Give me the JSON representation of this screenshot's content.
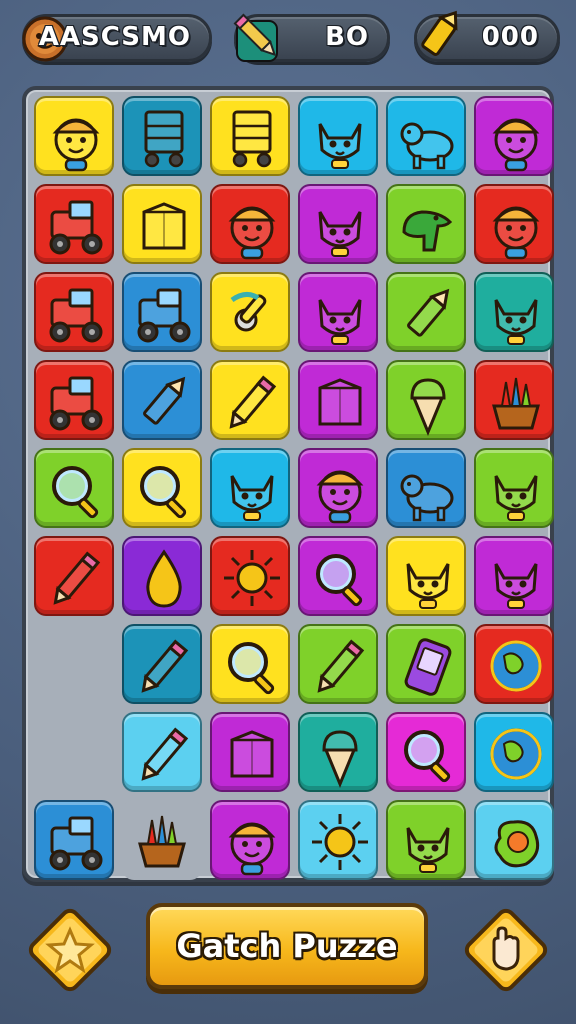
{
  "header": {
    "player_name": "AASCSMO",
    "pencil_count": "BO",
    "coin_count": "000",
    "icons": [
      "avatar-icon",
      "pencil-icon",
      "crayon-icon"
    ]
  },
  "board": {
    "tiles": [
      {
        "row": 0,
        "col": 0,
        "bg": "#ffe11f",
        "icon": "kid-icon"
      },
      {
        "row": 0,
        "col": 1,
        "bg": "#1c93b8",
        "icon": "cart-icon"
      },
      {
        "row": 0,
        "col": 2,
        "bg": "#ffe11f",
        "icon": "cart-icon"
      },
      {
        "row": 0,
        "col": 3,
        "bg": "#1fb8e8",
        "icon": "cat-icon"
      },
      {
        "row": 0,
        "col": 4,
        "bg": "#1fb8e8",
        "icon": "bear-icon"
      },
      {
        "row": 0,
        "col": 5,
        "bg": "#c02ad6",
        "icon": "kid-icon"
      },
      {
        "row": 1,
        "col": 0,
        "bg": "#e52a20",
        "icon": "tractor-icon"
      },
      {
        "row": 1,
        "col": 1,
        "bg": "#ffe11f",
        "icon": "box-icon"
      },
      {
        "row": 1,
        "col": 2,
        "bg": "#e52a20",
        "icon": "kid-icon"
      },
      {
        "row": 1,
        "col": 3,
        "bg": "#c02ad6",
        "icon": "cat-icon"
      },
      {
        "row": 1,
        "col": 4,
        "bg": "#7fd12a",
        "icon": "dino-icon"
      },
      {
        "row": 1,
        "col": 5,
        "bg": "#e52a20",
        "icon": "kid-icon"
      },
      {
        "row": 2,
        "col": 0,
        "bg": "#e52a20",
        "icon": "tractor-icon"
      },
      {
        "row": 2,
        "col": 1,
        "bg": "#2c8fd6",
        "icon": "tractor-icon"
      },
      {
        "row": 2,
        "col": 2,
        "bg": "#ffe11f",
        "icon": "tool-icon"
      },
      {
        "row": 2,
        "col": 3,
        "bg": "#c02ad6",
        "icon": "cat-icon"
      },
      {
        "row": 2,
        "col": 4,
        "bg": "#7fd12a",
        "icon": "crayon-icon"
      },
      {
        "row": 2,
        "col": 5,
        "bg": "#1fae9e",
        "icon": "cat-icon"
      },
      {
        "row": 3,
        "col": 0,
        "bg": "#e52a20",
        "icon": "tractor-icon"
      },
      {
        "row": 3,
        "col": 1,
        "bg": "#2c8fd6",
        "icon": "crayon-icon"
      },
      {
        "row": 3,
        "col": 2,
        "bg": "#ffe11f",
        "icon": "pencil-icon"
      },
      {
        "row": 3,
        "col": 3,
        "bg": "#c02ad6",
        "icon": "box-icon"
      },
      {
        "row": 3,
        "col": 4,
        "bg": "#7fd12a",
        "icon": "icecream-icon"
      },
      {
        "row": 3,
        "col": 5,
        "bg": "#e52a20",
        "icon": "basket-icon"
      },
      {
        "row": 4,
        "col": 0,
        "bg": "#7fd12a",
        "icon": "magnifier-icon"
      },
      {
        "row": 4,
        "col": 1,
        "bg": "#ffe11f",
        "icon": "magnifier-icon"
      },
      {
        "row": 4,
        "col": 2,
        "bg": "#1fb8e8",
        "icon": "cat-icon"
      },
      {
        "row": 4,
        "col": 3,
        "bg": "#c02ad6",
        "icon": "kid-icon"
      },
      {
        "row": 4,
        "col": 4,
        "bg": "#2c8fd6",
        "icon": "bear-icon"
      },
      {
        "row": 4,
        "col": 5,
        "bg": "#7fd12a",
        "icon": "cat-icon"
      },
      {
        "row": 5,
        "col": 0,
        "bg": "#e52a20",
        "icon": "pencil-icon"
      },
      {
        "row": 5,
        "col": 1,
        "bg": "#8a2ad6",
        "icon": "drop-icon"
      },
      {
        "row": 5,
        "col": 2,
        "bg": "#e52a20",
        "icon": "sun-icon"
      },
      {
        "row": 5,
        "col": 3,
        "bg": "#c02ad6",
        "icon": "magnifier-icon"
      },
      {
        "row": 5,
        "col": 4,
        "bg": "#ffe11f",
        "icon": "cat-icon"
      },
      {
        "row": 5,
        "col": 5,
        "bg": "#c02ad6",
        "icon": "cat-icon"
      },
      {
        "row": 6,
        "col": 1,
        "bg": "#1c93b8",
        "icon": "pencil-icon"
      },
      {
        "row": 6,
        "col": 2,
        "bg": "#ffe11f",
        "icon": "magnifier-icon"
      },
      {
        "row": 6,
        "col": 3,
        "bg": "#7fd12a",
        "icon": "pencil-icon"
      },
      {
        "row": 6,
        "col": 4,
        "bg": "#7fd12a",
        "icon": "phone-icon"
      },
      {
        "row": 6,
        "col": 5,
        "bg": "#e52a20",
        "icon": "globe-icon"
      },
      {
        "row": 7,
        "col": 1,
        "bg": "#5cd0f0",
        "icon": "pencil-icon"
      },
      {
        "row": 7,
        "col": 2,
        "bg": "#c02ad6",
        "icon": "box-icon"
      },
      {
        "row": 7,
        "col": 3,
        "bg": "#1fae9e",
        "icon": "icecream-icon"
      },
      {
        "row": 7,
        "col": 4,
        "bg": "#e52ad6",
        "icon": "magnifier-icon"
      },
      {
        "row": 7,
        "col": 5,
        "bg": "#1fb8e8",
        "icon": "globe-icon"
      },
      {
        "row": 8,
        "col": 0,
        "bg": "#2c8fd6",
        "icon": "tractor-icon"
      },
      {
        "row": 8,
        "col": 1,
        "bg": "#a7afb9",
        "icon": "basket-icon"
      },
      {
        "row": 8,
        "col": 2,
        "bg": "#c02ad6",
        "icon": "kid-icon"
      },
      {
        "row": 8,
        "col": 3,
        "bg": "#5cd0f0",
        "icon": "sun-icon"
      },
      {
        "row": 8,
        "col": 4,
        "bg": "#7fd12a",
        "icon": "cat-icon"
      },
      {
        "row": 8,
        "col": 5,
        "bg": "#5cd0f0",
        "icon": "blob-icon"
      }
    ]
  },
  "footer": {
    "main_button_label": "Gatch Puzze",
    "left_button_icon": "star-icon",
    "right_button_icon": "hand-icon"
  }
}
